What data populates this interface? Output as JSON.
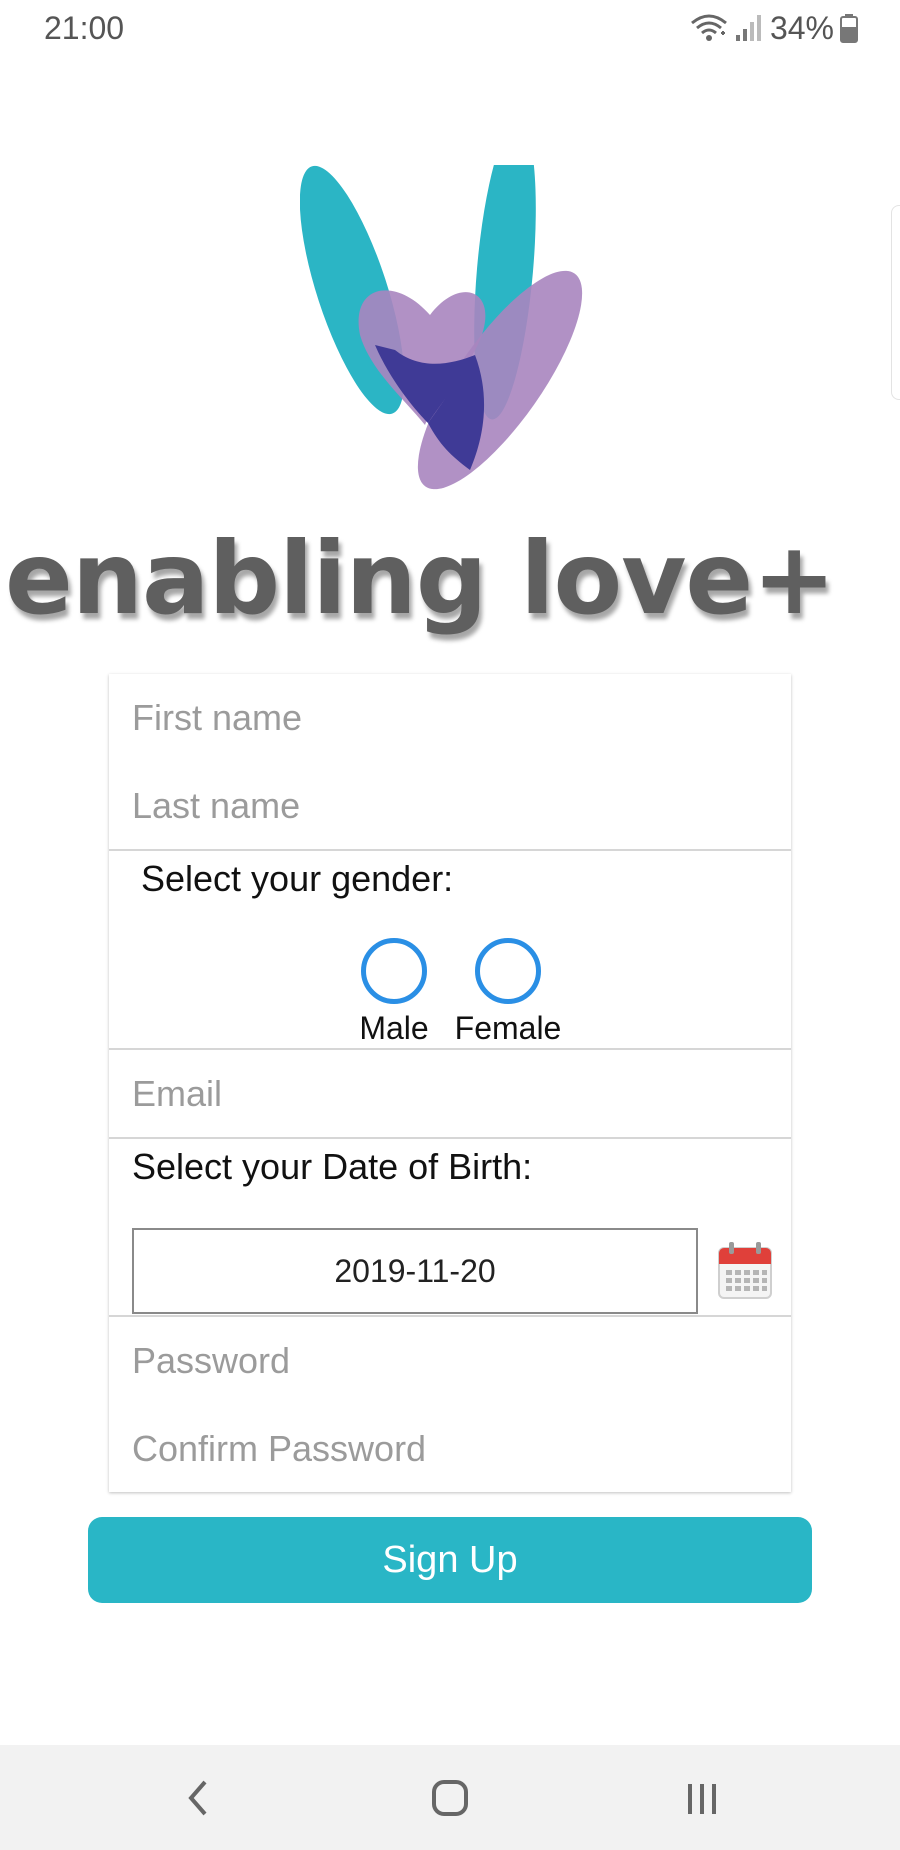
{
  "status_bar": {
    "time": "21:00",
    "battery": "34%",
    "icons": [
      "wifi-icon",
      "signal-icon",
      "battery-icon"
    ]
  },
  "brand": {
    "name": "enabling love+",
    "logo": "heart-leaves-logo",
    "colors": {
      "teal": "#2bb5c5",
      "purple": "#a985bf",
      "overlap": "#3f3a96"
    }
  },
  "form": {
    "first_name_placeholder": "First name",
    "last_name_placeholder": "Last name",
    "gender_label": "Select your gender:",
    "gender_options": [
      {
        "label": "Male",
        "selected": false
      },
      {
        "label": "Female",
        "selected": false
      }
    ],
    "email_placeholder": "Email",
    "dob_label": "Select your Date of Birth:",
    "dob_value": "2019-11-20",
    "password_placeholder": "Password",
    "confirm_password_placeholder": "Confirm Password"
  },
  "actions": {
    "signup_label": "Sign Up",
    "accent_color": "#29b6c6"
  },
  "nav_bar": {
    "icons": [
      "back-icon",
      "home-icon",
      "recents-icon"
    ]
  }
}
